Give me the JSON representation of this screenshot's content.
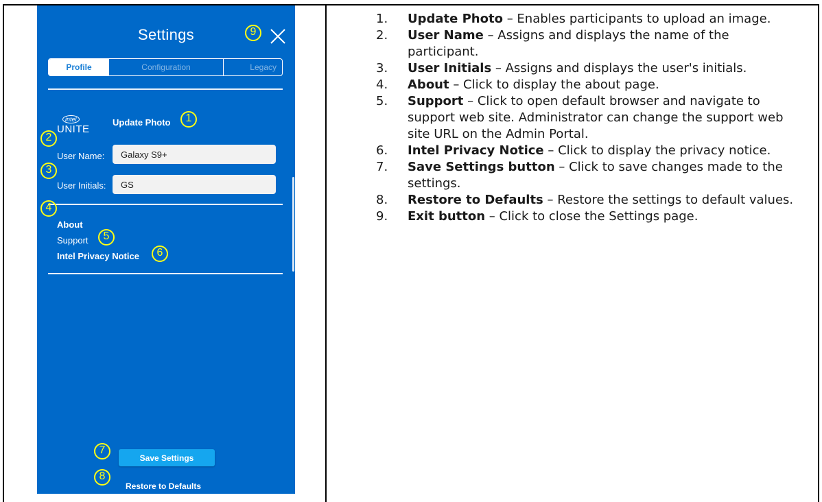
{
  "settings": {
    "title": "Settings",
    "tabs": [
      {
        "label": "Profile"
      },
      {
        "label": "Configuration"
      },
      {
        "label": "Legacy"
      }
    ],
    "logo": {
      "intel": "intel",
      "unite": "UNITE"
    },
    "update_photo": "Update Photo",
    "user_name": {
      "label": "User Name:",
      "value": "Galaxy S9+"
    },
    "user_initials": {
      "label": "User Initials:",
      "value": "GS"
    },
    "links": {
      "about": "About",
      "support": "Support",
      "privacy": "Intel Privacy Notice"
    },
    "save_button": "Save Settings",
    "restore": "Restore to Defaults"
  },
  "callouts": [
    "1",
    "2",
    "3",
    "4",
    "5",
    "6",
    "7",
    "8",
    "9"
  ],
  "legend": [
    {
      "num": "1.",
      "term": "Update Photo",
      "desc": " – Enables participants to upload an image."
    },
    {
      "num": "2.",
      "term": "User Name",
      "desc": " – Assigns and displays the name of the participant."
    },
    {
      "num": "3.",
      "term": "User Initials",
      "desc": " – Assigns and displays the user's initials."
    },
    {
      "num": "4.",
      "term": "About",
      "desc": " – Click to display the about page."
    },
    {
      "num": "5.",
      "term": "Support",
      "desc": " – Click to open default browser and navigate to support web site. Administrator can change the support web site URL on the Admin Portal."
    },
    {
      "num": "6.",
      "term": "Intel Privacy Notice",
      "desc": " – Click to display the privacy notice."
    },
    {
      "num": "7.",
      "term": "Save Settings button",
      "desc": " – Click to save changes made to the settings."
    },
    {
      "num": "8.",
      "term": "Restore to Defaults",
      "desc": " – Restore the settings to default values."
    },
    {
      "num": "9.",
      "term": "Exit button",
      "desc": " – Click to close the Settings page."
    }
  ],
  "colors": {
    "panel": "#0069c9",
    "callout": "#ffff14",
    "save_button": "#15a6ef"
  },
  "icons": {
    "close": "close-icon"
  }
}
